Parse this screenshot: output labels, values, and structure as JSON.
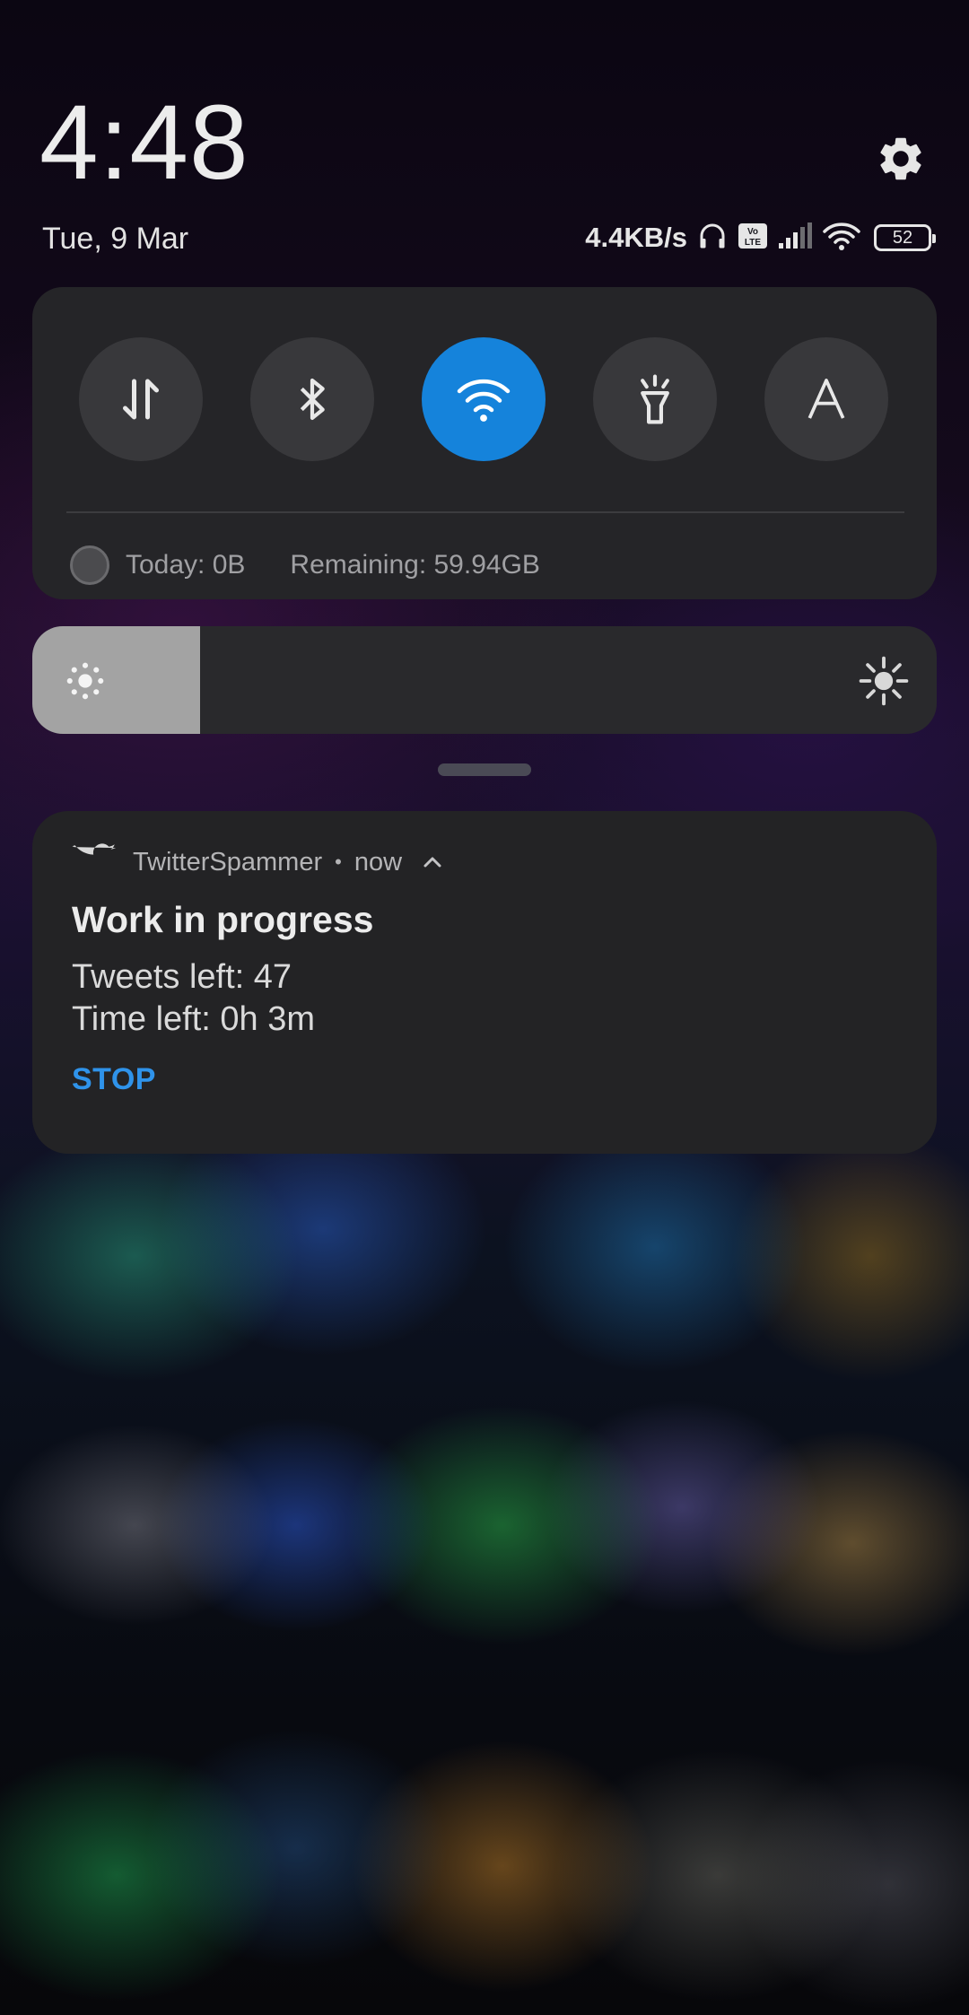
{
  "header": {
    "time": "4:48",
    "date": "Tue, 9 Mar",
    "net_speed": "4.4KB/s",
    "volte_label": "Vo LTE",
    "battery_level": "52"
  },
  "quick_settings": {
    "tiles": [
      {
        "icon": "mobile-data-icon",
        "active": false
      },
      {
        "icon": "bluetooth-icon",
        "active": false
      },
      {
        "icon": "wifi-icon",
        "active": true
      },
      {
        "icon": "flashlight-icon",
        "active": false
      },
      {
        "icon": "auto-brightness-icon",
        "active": false,
        "glyph": "A"
      }
    ],
    "data_today": "Today: 0B",
    "data_remaining": "Remaining: 59.94GB"
  },
  "brightness": {
    "level_fraction": 0.186
  },
  "notification": {
    "app_name": "TwitterSpammer",
    "separator": "•",
    "time": "now",
    "title": "Work in progress",
    "line1": "Tweets left: 47",
    "line2": "Time left: 0h 3m",
    "action": "STOP"
  },
  "colors": {
    "accent": "#1583db",
    "action_text": "#2f93ea",
    "card_bg": "#252528"
  }
}
